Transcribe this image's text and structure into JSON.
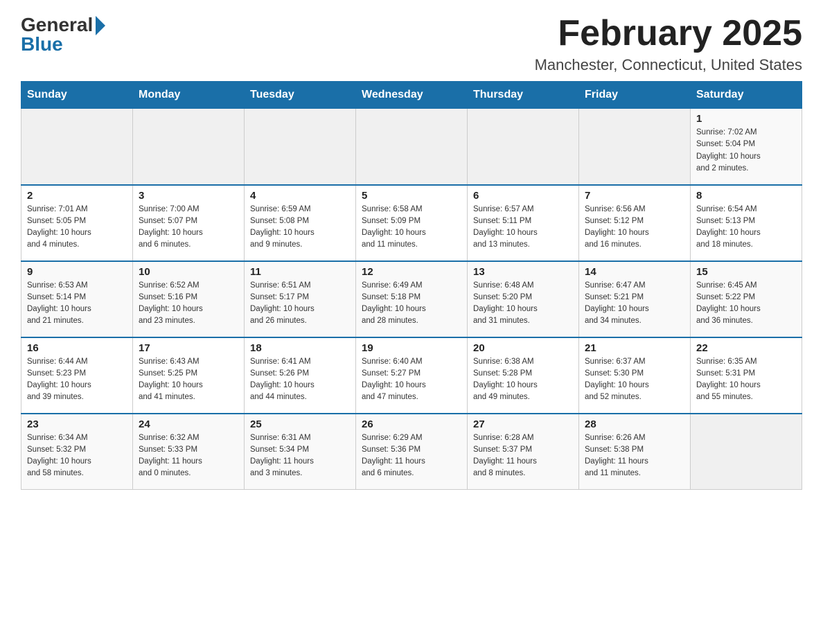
{
  "logo": {
    "general": "General",
    "blue": "Blue"
  },
  "header": {
    "title": "February 2025",
    "location": "Manchester, Connecticut, United States"
  },
  "weekdays": [
    "Sunday",
    "Monday",
    "Tuesday",
    "Wednesday",
    "Thursday",
    "Friday",
    "Saturday"
  ],
  "weeks": [
    [
      {
        "day": "",
        "info": ""
      },
      {
        "day": "",
        "info": ""
      },
      {
        "day": "",
        "info": ""
      },
      {
        "day": "",
        "info": ""
      },
      {
        "day": "",
        "info": ""
      },
      {
        "day": "",
        "info": ""
      },
      {
        "day": "1",
        "info": "Sunrise: 7:02 AM\nSunset: 5:04 PM\nDaylight: 10 hours\nand 2 minutes."
      }
    ],
    [
      {
        "day": "2",
        "info": "Sunrise: 7:01 AM\nSunset: 5:05 PM\nDaylight: 10 hours\nand 4 minutes."
      },
      {
        "day": "3",
        "info": "Sunrise: 7:00 AM\nSunset: 5:07 PM\nDaylight: 10 hours\nand 6 minutes."
      },
      {
        "day": "4",
        "info": "Sunrise: 6:59 AM\nSunset: 5:08 PM\nDaylight: 10 hours\nand 9 minutes."
      },
      {
        "day": "5",
        "info": "Sunrise: 6:58 AM\nSunset: 5:09 PM\nDaylight: 10 hours\nand 11 minutes."
      },
      {
        "day": "6",
        "info": "Sunrise: 6:57 AM\nSunset: 5:11 PM\nDaylight: 10 hours\nand 13 minutes."
      },
      {
        "day": "7",
        "info": "Sunrise: 6:56 AM\nSunset: 5:12 PM\nDaylight: 10 hours\nand 16 minutes."
      },
      {
        "day": "8",
        "info": "Sunrise: 6:54 AM\nSunset: 5:13 PM\nDaylight: 10 hours\nand 18 minutes."
      }
    ],
    [
      {
        "day": "9",
        "info": "Sunrise: 6:53 AM\nSunset: 5:14 PM\nDaylight: 10 hours\nand 21 minutes."
      },
      {
        "day": "10",
        "info": "Sunrise: 6:52 AM\nSunset: 5:16 PM\nDaylight: 10 hours\nand 23 minutes."
      },
      {
        "day": "11",
        "info": "Sunrise: 6:51 AM\nSunset: 5:17 PM\nDaylight: 10 hours\nand 26 minutes."
      },
      {
        "day": "12",
        "info": "Sunrise: 6:49 AM\nSunset: 5:18 PM\nDaylight: 10 hours\nand 28 minutes."
      },
      {
        "day": "13",
        "info": "Sunrise: 6:48 AM\nSunset: 5:20 PM\nDaylight: 10 hours\nand 31 minutes."
      },
      {
        "day": "14",
        "info": "Sunrise: 6:47 AM\nSunset: 5:21 PM\nDaylight: 10 hours\nand 34 minutes."
      },
      {
        "day": "15",
        "info": "Sunrise: 6:45 AM\nSunset: 5:22 PM\nDaylight: 10 hours\nand 36 minutes."
      }
    ],
    [
      {
        "day": "16",
        "info": "Sunrise: 6:44 AM\nSunset: 5:23 PM\nDaylight: 10 hours\nand 39 minutes."
      },
      {
        "day": "17",
        "info": "Sunrise: 6:43 AM\nSunset: 5:25 PM\nDaylight: 10 hours\nand 41 minutes."
      },
      {
        "day": "18",
        "info": "Sunrise: 6:41 AM\nSunset: 5:26 PM\nDaylight: 10 hours\nand 44 minutes."
      },
      {
        "day": "19",
        "info": "Sunrise: 6:40 AM\nSunset: 5:27 PM\nDaylight: 10 hours\nand 47 minutes."
      },
      {
        "day": "20",
        "info": "Sunrise: 6:38 AM\nSunset: 5:28 PM\nDaylight: 10 hours\nand 49 minutes."
      },
      {
        "day": "21",
        "info": "Sunrise: 6:37 AM\nSunset: 5:30 PM\nDaylight: 10 hours\nand 52 minutes."
      },
      {
        "day": "22",
        "info": "Sunrise: 6:35 AM\nSunset: 5:31 PM\nDaylight: 10 hours\nand 55 minutes."
      }
    ],
    [
      {
        "day": "23",
        "info": "Sunrise: 6:34 AM\nSunset: 5:32 PM\nDaylight: 10 hours\nand 58 minutes."
      },
      {
        "day": "24",
        "info": "Sunrise: 6:32 AM\nSunset: 5:33 PM\nDaylight: 11 hours\nand 0 minutes."
      },
      {
        "day": "25",
        "info": "Sunrise: 6:31 AM\nSunset: 5:34 PM\nDaylight: 11 hours\nand 3 minutes."
      },
      {
        "day": "26",
        "info": "Sunrise: 6:29 AM\nSunset: 5:36 PM\nDaylight: 11 hours\nand 6 minutes."
      },
      {
        "day": "27",
        "info": "Sunrise: 6:28 AM\nSunset: 5:37 PM\nDaylight: 11 hours\nand 8 minutes."
      },
      {
        "day": "28",
        "info": "Sunrise: 6:26 AM\nSunset: 5:38 PM\nDaylight: 11 hours\nand 11 minutes."
      },
      {
        "day": "",
        "info": ""
      }
    ]
  ]
}
